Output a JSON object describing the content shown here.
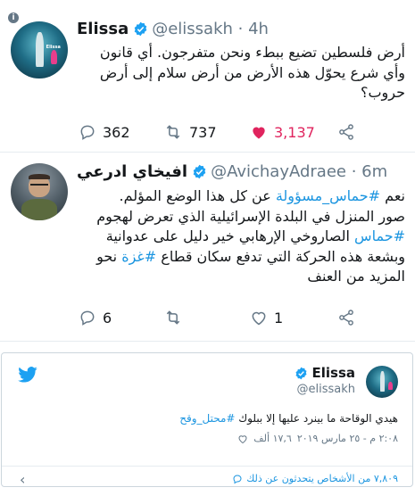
{
  "tweets": [
    {
      "name": "Elissa",
      "handle": "@elissakh · 4h",
      "text": "أرض فلسطين تضيع ببطء ونحن متفرجون. أي قانون وأي شرع يحوّل هذه الأرض من أرض سلام إلى أرض حروب؟",
      "actions": {
        "replies": "362",
        "retweets": "737",
        "likes": "3,137"
      }
    },
    {
      "name": "افيخاي ادرعي",
      "handle": "@AvichayAdraee · 6m",
      "text_parts": {
        "p1": "نعم ",
        "tag1": "#حماس_مسؤولة",
        "p2": " عن كل هذا الوضع المؤلم.",
        "p3": "صور المنزل في البلدة الإسرائيلية الذي تعرض لهجوم ",
        "tag2": "#حماس",
        "p4": " الصاروخي الإرهابي خير دليل على عدوانية وبشعة هذه الحركة التي تدفع سكان قطاع ",
        "tag3": "#غزة",
        "p5": " نحو المزيد من العنف"
      },
      "actions": {
        "replies": "6",
        "retweets": "",
        "likes": "1"
      }
    }
  ],
  "embed": {
    "name": "Elissa",
    "handle": "@elissakh",
    "text": "هيدي الوقاحة ما بينرد عليها إلا ببلوك ",
    "hashtag": "#محتل_وقح",
    "likes": "١٧,٦ ألف",
    "time": "٢:٠٨ م - ٢٥ مارس ٢٠١٩",
    "footer": "٧,٨٠٩ من الأشخاص يتحدثون عن ذلك"
  },
  "colors": {
    "brand": "#1da1f2",
    "link": "#1b95e0",
    "like": "#e0245e",
    "muted": "#657786"
  }
}
